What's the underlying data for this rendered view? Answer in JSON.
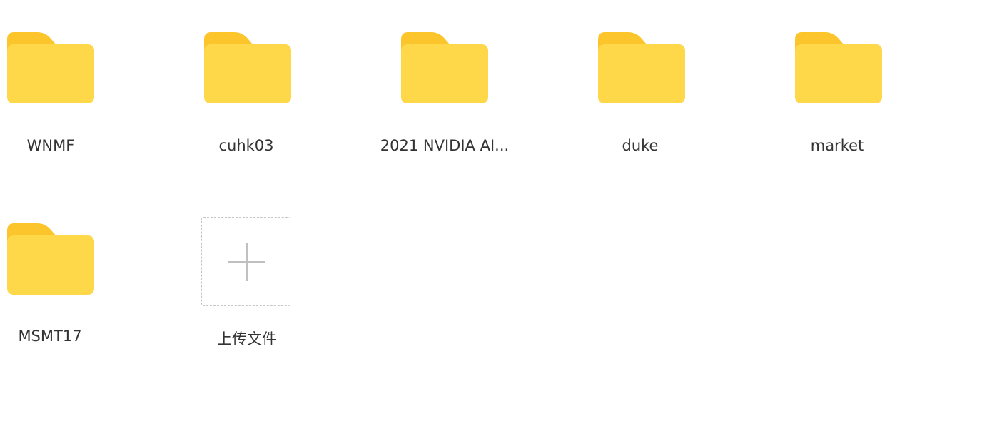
{
  "colors": {
    "folder_back": "#FDC52C",
    "folder_front": "#FFD84A",
    "upload_border": "#C4C4C4",
    "upload_plus": "#C0C0C0",
    "label_text": "#333333"
  },
  "folders": [
    {
      "label": "WNMF",
      "icon": "folder-icon"
    },
    {
      "label": "cuhk03",
      "icon": "folder-icon"
    },
    {
      "label": "2021 NVIDIA AI...",
      "icon": "folder-icon"
    },
    {
      "label": "duke",
      "icon": "folder-icon"
    },
    {
      "label": "market",
      "icon": "folder-icon"
    },
    {
      "label": "MSMT17",
      "icon": "folder-icon"
    }
  ],
  "upload": {
    "label": "上传文件",
    "icon": "plus-icon"
  }
}
